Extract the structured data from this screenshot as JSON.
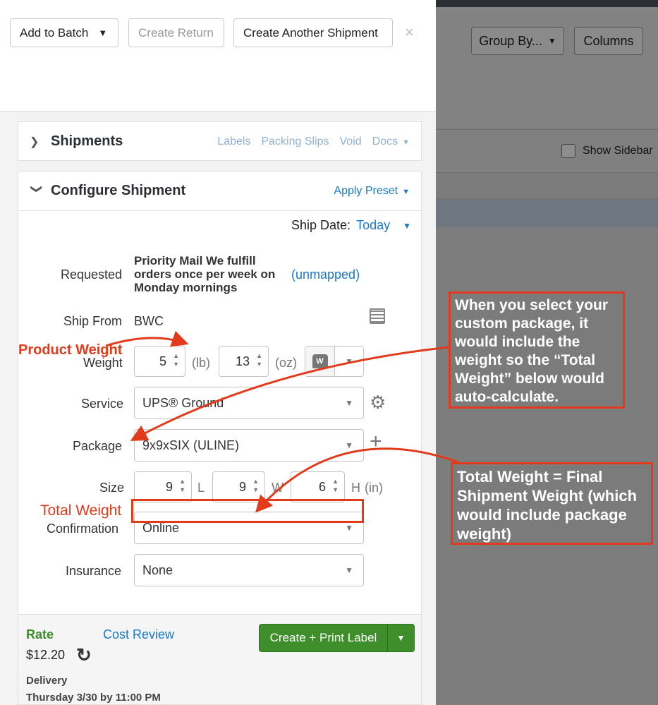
{
  "background_app": {
    "group_by_label": "Group By...",
    "columns_label": "Columns",
    "show_sidebar_label": "Show Sidebar"
  },
  "toolbar": {
    "add_to_batch_label": "Add to Batch",
    "create_return_label": "Create Return",
    "create_another_label": "Create Another Shipment",
    "close_glyph": "×"
  },
  "shipments_card": {
    "title": "Shipments",
    "links": [
      "Labels",
      "Packing Slips",
      "Void",
      "Docs"
    ]
  },
  "configure": {
    "title": "Configure Shipment",
    "apply_preset_label": "Apply Preset",
    "ship_date_label": "Ship Date:",
    "ship_date_value": "Today",
    "requested_label": "Requested",
    "requested_value": "Priority Mail We fulfill orders once per week on Monday mornings",
    "unmapped_label": "(unmapped)",
    "ship_from_label": "Ship From",
    "ship_from_value": "BWC",
    "weight_label": "Weight",
    "weight_lb": "5",
    "weight_lb_unit": "(lb)",
    "weight_oz": "13",
    "weight_oz_unit": "(oz)",
    "service_label": "Service",
    "service_value": "UPS® Ground",
    "package_label": "Package",
    "package_value": "9x9xSIX (ULINE)",
    "size_label": "Size",
    "size_l": "9",
    "size_l_unit": "L",
    "size_w": "9",
    "size_w_unit": "W",
    "size_h": "6",
    "size_h_unit": "H",
    "size_units": "(in)",
    "confirmation_label": "Confirmation",
    "confirmation_value": "Online",
    "insurance_label": "Insurance",
    "insurance_value": "None"
  },
  "footer": {
    "rate_label": "Rate",
    "cost_review_label": "Cost Review",
    "rate_value": "$12.20",
    "create_label": "Create + Print Label",
    "delivery_label": "Delivery",
    "delivery_value": "Thursday 3/30 by 11:00 PM"
  },
  "annotations": {
    "product_weight": "Product Weight",
    "total_weight": "Total Weight",
    "callout_package": "When you select your custom package, it would include the weight so the “Total Weight” below would auto-calculate.",
    "callout_total": "Total Weight = Final Shipment Weight (which would include package weight)",
    "color": "#e23b1c"
  }
}
